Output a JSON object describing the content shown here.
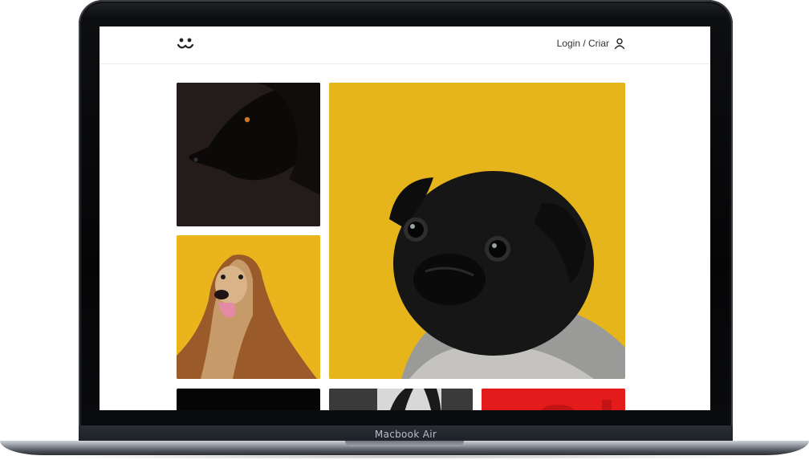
{
  "device": {
    "label": "Macbook Air"
  },
  "header": {
    "logo_icon": "dog-face-logo-icon",
    "login_label": "Login / Criar",
    "login_icon": "user-icon"
  },
  "feed": {
    "photos": [
      {
        "subject": "black dog portrait on dark background",
        "background": "#241c1c"
      },
      {
        "subject": "black pug wearing knitted sweater",
        "background": "#e5b51b"
      },
      {
        "subject": "afghan hound on yellow background",
        "background": "#eab51c"
      },
      {
        "subject": "dark photo",
        "background": "#050505"
      },
      {
        "subject": "dog ears on grey background",
        "background": "#3f3f3f"
      },
      {
        "subject": "red background photo",
        "background": "#e41b1b"
      }
    ]
  }
}
